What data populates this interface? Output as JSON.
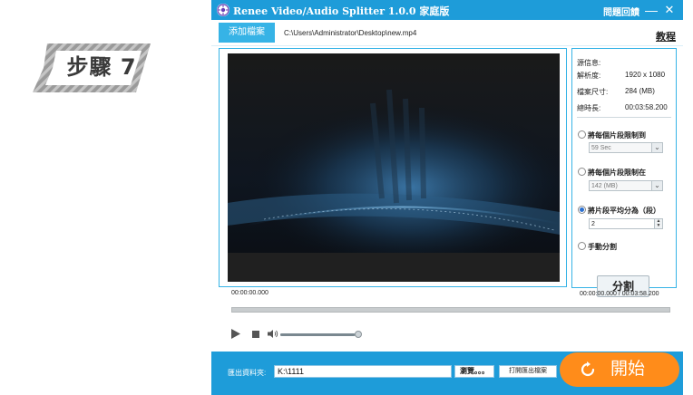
{
  "step_badge": {
    "text": "步驟 7"
  },
  "window": {
    "title": "Renee Video/Audio Splitter 1.0.0 家庭版",
    "feedback_label": "問題回饋",
    "minimize_glyph": "—",
    "close_glyph": "✕"
  },
  "toolbar": {
    "add_file_label": "添加檔案",
    "file_path": "C:\\Users\\Administrator\\Desktop\\new.mp4",
    "tutorial_label": "教程"
  },
  "info": {
    "source_label": "源信息:",
    "resolution_label": "解析度:",
    "resolution_value": "1920 x 1080",
    "filesize_label": "檔案尺寸:",
    "filesize_value": "284 (MB)",
    "duration_label": "總時長:",
    "duration_value": "00:03:58.200"
  },
  "split_options": [
    {
      "label": "將每個片段限制到",
      "control": "dropdown",
      "value": "59 Sec",
      "checked": false
    },
    {
      "label": "將每個片段限制在",
      "control": "dropdown",
      "value": "142 (MB)",
      "checked": false
    },
    {
      "label": "將片段平均分為（段）",
      "control": "spinner",
      "value": "2",
      "checked": true
    },
    {
      "label": "手動分割",
      "control": "none",
      "value": "",
      "checked": false
    }
  ],
  "split_button_label": "分割",
  "playback": {
    "current_time": "00:00:00.000",
    "total_time": "00:00:00.000 / 00:03:58.200",
    "progress_fraction": 0.0,
    "volume_fraction": 0.95
  },
  "output": {
    "label": "匯出資料夾:",
    "folder_value": "K:\\1111",
    "browse_label": "瀏覽。。。",
    "open_folder_label": "打開匯出檔案",
    "start_label": "開始"
  },
  "colors": {
    "accent": "#1e9cd9",
    "start_button": "#ff8c1a",
    "radio_checked": "#2b6fd0"
  }
}
